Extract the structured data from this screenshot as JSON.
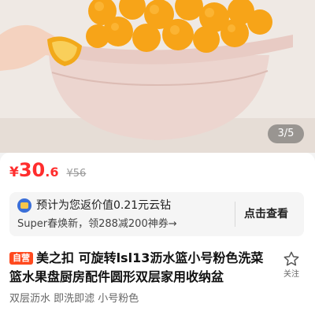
{
  "gallery": {
    "page_indicator": "3/5"
  },
  "price": {
    "currency": "¥",
    "integer": "30",
    "decimal": ".6",
    "original": "¥56",
    "color": "#ff2d2d"
  },
  "promo": {
    "icon": "coin-icon",
    "line1": "预计为您返价值0.21元云钻",
    "line2": "Super春焕新，领288减200神券→",
    "action": "点击查看"
  },
  "product": {
    "badge": "自营",
    "title": "美之扣 可旋转lsl13沥水篮小号粉色洗菜篮水果盘厨房配件圆形双层家用收纳盆",
    "favorite_label": "关注",
    "favorite_icon": "star-outline-icon",
    "tags": "双层沥水 即洗即滤 小号粉色"
  }
}
